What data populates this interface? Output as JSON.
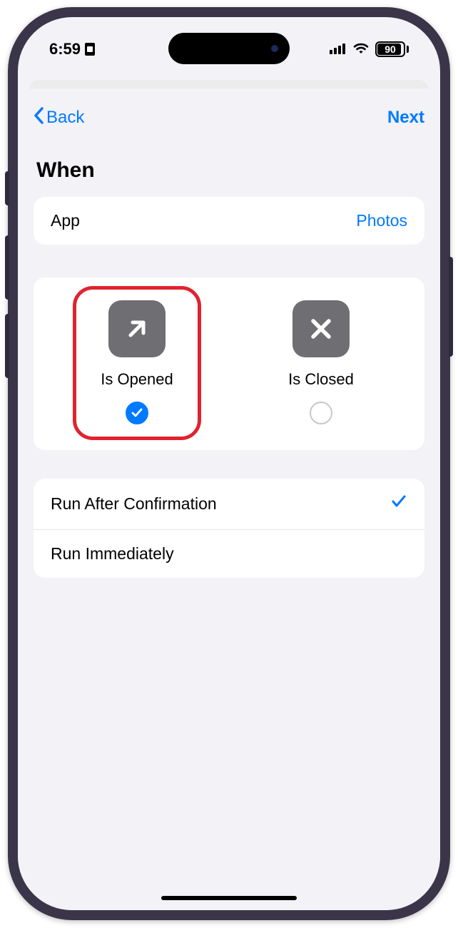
{
  "status": {
    "time": "6:59",
    "battery": "90"
  },
  "nav": {
    "back": "Back",
    "next": "Next"
  },
  "title": "When",
  "app_row": {
    "label": "App",
    "value": "Photos"
  },
  "options": {
    "opened": {
      "label": "Is Opened",
      "selected": true
    },
    "closed": {
      "label": "Is Closed",
      "selected": false
    }
  },
  "run": {
    "after_confirmation": {
      "label": "Run After Confirmation",
      "selected": true
    },
    "immediately": {
      "label": "Run Immediately",
      "selected": false
    }
  },
  "highlight": "opened"
}
